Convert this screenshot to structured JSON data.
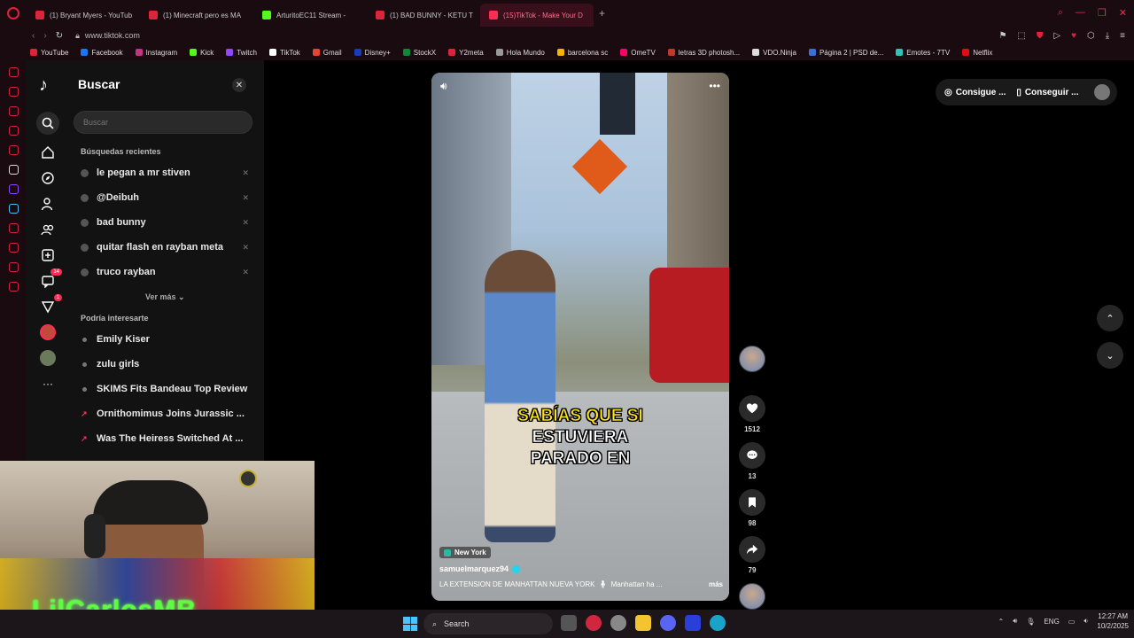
{
  "browser": {
    "tabs": [
      {
        "label": "(1) Bryant Myers - YouTub",
        "color": "#e0223a"
      },
      {
        "label": "(1) Minecraft pero es MA",
        "color": "#e0223a"
      },
      {
        "label": "ArturitoEC11 Stream -",
        "color": "#53fc18"
      },
      {
        "label": "(1) BAD BUNNY - KETU T",
        "color": "#e0223a"
      },
      {
        "label": "(15)TikTok - Make Your D",
        "color": "#fe2c55"
      }
    ],
    "url": "www.tiktok.com",
    "bookmarks": [
      {
        "label": "YouTube",
        "color": "#e0223a"
      },
      {
        "label": "Facebook",
        "color": "#1877f2"
      },
      {
        "label": "Instagram",
        "color": "#c13584"
      },
      {
        "label": "Kick",
        "color": "#53fc18"
      },
      {
        "label": "Twitch",
        "color": "#9146ff"
      },
      {
        "label": "TikTok",
        "color": "#ffffff"
      },
      {
        "label": "Gmail",
        "color": "#ea4335"
      },
      {
        "label": "Disney+",
        "color": "#1b3bbd"
      },
      {
        "label": "StockX",
        "color": "#0a8a3a"
      },
      {
        "label": "Y2meta",
        "color": "#e0223a"
      },
      {
        "label": "Hola Mundo",
        "color": "#999999"
      },
      {
        "label": "barcelona sc",
        "color": "#f4b400"
      },
      {
        "label": "OmeTV",
        "color": "#f06"
      },
      {
        "label": "letras 3D photosh...",
        "color": "#c0392b"
      },
      {
        "label": "VDO.Ninja",
        "color": "#dddddd"
      },
      {
        "label": "Página 2 | PSD de...",
        "color": "#3b6fd8"
      },
      {
        "label": "Emotes - 7TV",
        "color": "#2ec4b6"
      },
      {
        "label": "Netflix",
        "color": "#e50914"
      }
    ]
  },
  "tiktok": {
    "logo": "♪",
    "nav_badges": {
      "messages": "14",
      "activity": "1"
    },
    "search_drawer": {
      "title": "Buscar",
      "placeholder": "Buscar",
      "recent_label": "Búsquedas recientes",
      "recent": [
        "le pegan a mr stiven",
        "@Deibuh",
        "bad bunny",
        "quitar flash en rayban meta",
        "truco rayban"
      ],
      "see_more": "Ver más",
      "suggest_label": "Podría interesarte",
      "suggestions": [
        {
          "text": "Emily Kiser",
          "trending": false
        },
        {
          "text": "zulu girls",
          "trending": false
        },
        {
          "text": "SKIMS Fits Bandeau Top Review",
          "trending": false
        },
        {
          "text": "Ornithomimus Joins Jurassic ...",
          "trending": true
        },
        {
          "text": "Was The Heiress Switched At ...",
          "trending": true
        }
      ]
    },
    "video": {
      "caption_line1": "SABÍAS QUE SI",
      "caption_line2": "ESTUVIERA",
      "caption_line3": "PARADO EN",
      "location": "New York",
      "author": "samuelmarquez94",
      "description": "LA EXTENSION DE MANHATTAN NUEVA YORK",
      "description_tag": "Manhattan ha ...",
      "more": "más"
    },
    "actions": {
      "likes": "1512",
      "comments": "13",
      "saves": "98",
      "shares": "79"
    },
    "top_right": {
      "get_coins": "Consigue ...",
      "get_app": "Conseguir ..."
    }
  },
  "webcam": {
    "overlay_name": "LilCarlosMB"
  },
  "taskbar": {
    "search_label": "Search",
    "lang": "ENG",
    "time": "12:27 AM",
    "date": "10/2/2025"
  }
}
